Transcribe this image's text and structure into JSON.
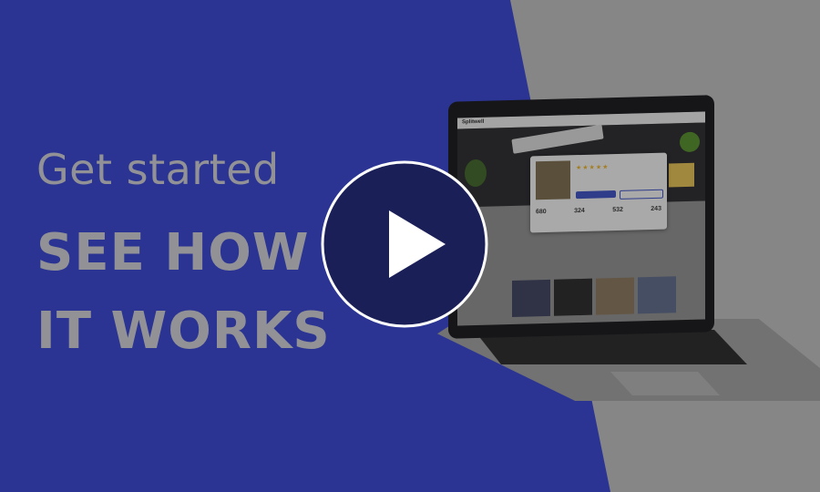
{
  "hero": {
    "subtitle": "Get started",
    "title_line1": "SEE HOW",
    "title_line2": "IT WORKS"
  },
  "colors": {
    "blue_panel": "#3540b4",
    "gray_bg": "#a4a4a4",
    "headline_text": "#b3b3b8",
    "play_circle": "#1b1f58",
    "play_icon": "#ffffff"
  },
  "play_button": {
    "icon": "play-icon"
  },
  "laptop_screen": {
    "logo": "Splitwell",
    "stats": [
      "680",
      "324",
      "532",
      "243"
    ]
  }
}
